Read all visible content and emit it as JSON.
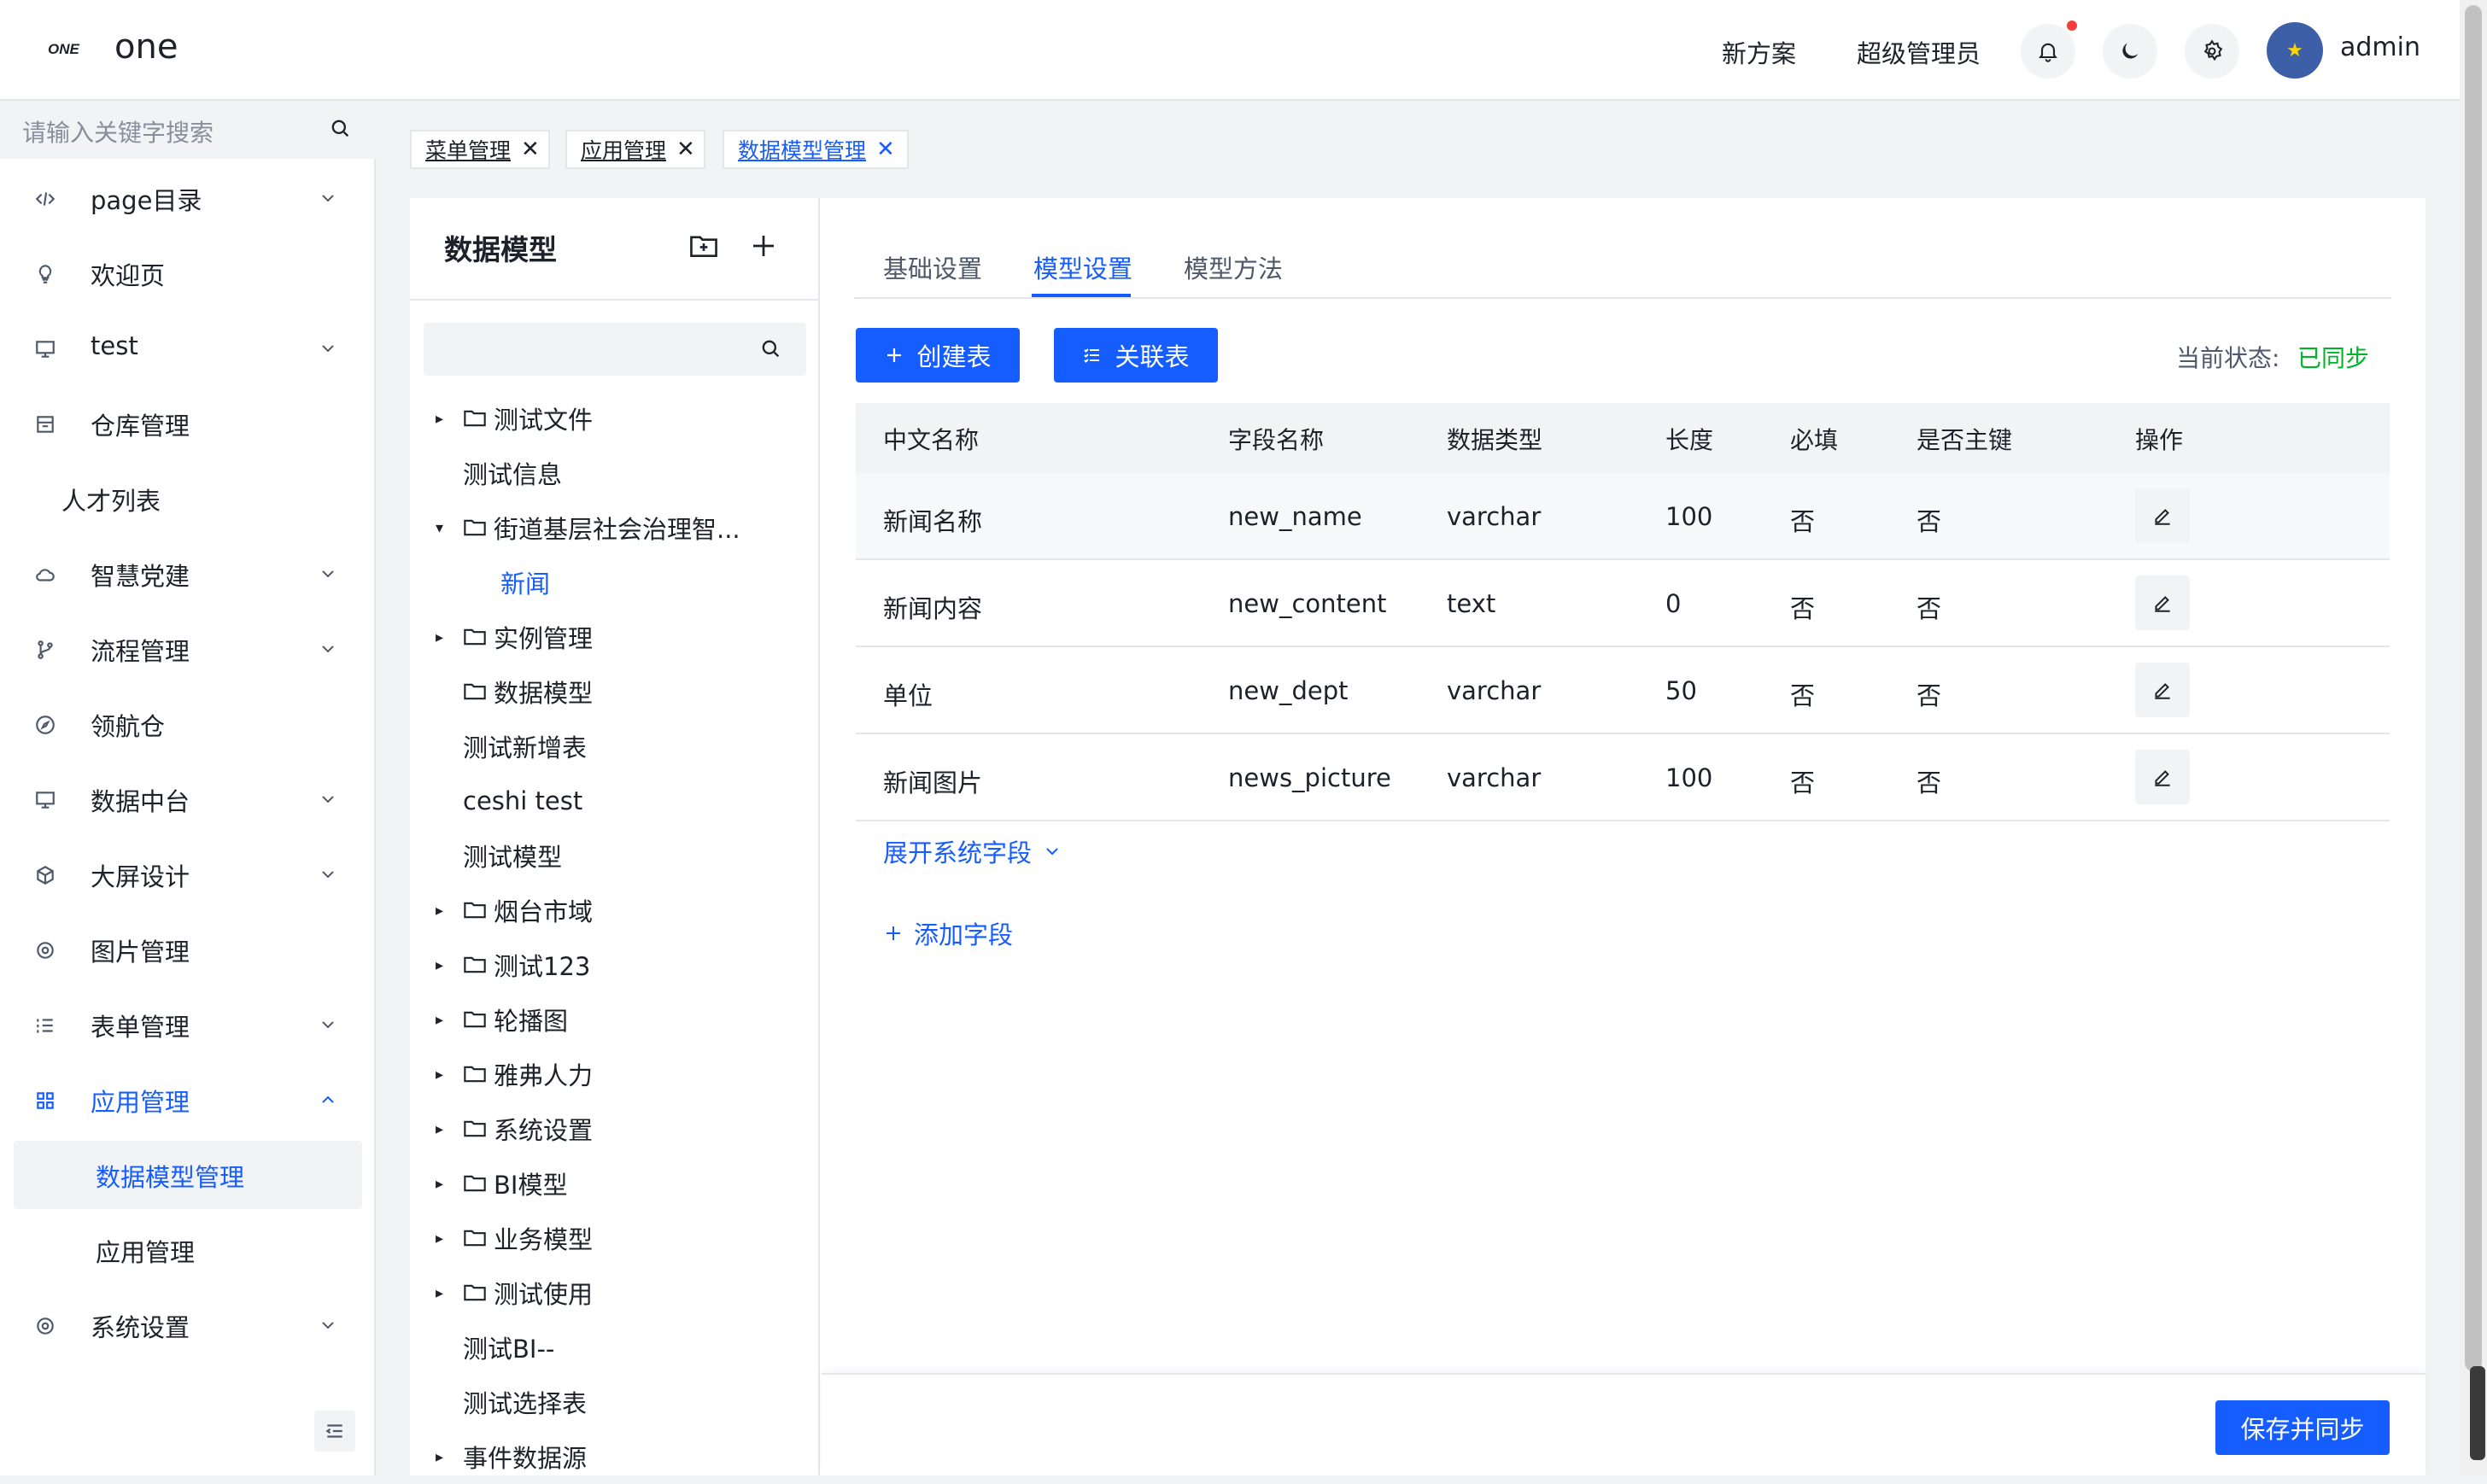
{
  "header": {
    "app_title": "one",
    "logo_text": "ONE",
    "links": [
      "新方案",
      "超级管理员"
    ],
    "user": "admin"
  },
  "sidebar": {
    "search_placeholder": "请输入关键字搜索",
    "items": [
      {
        "label": "page目录",
        "icon": "code-icon",
        "has_arrow": true
      },
      {
        "label": "欢迎页",
        "icon": "bulb-icon",
        "has_arrow": false
      },
      {
        "label": "test",
        "icon": "desktop-icon",
        "has_arrow": true
      },
      {
        "label": "仓库管理",
        "icon": "storage-icon",
        "has_arrow": false
      },
      {
        "label": "人才列表",
        "icon": "",
        "has_arrow": false
      },
      {
        "label": "智慧党建",
        "icon": "cloud-icon",
        "has_arrow": true
      },
      {
        "label": "流程管理",
        "icon": "branch-icon",
        "has_arrow": true
      },
      {
        "label": "领航仓",
        "icon": "compass-icon",
        "has_arrow": false
      },
      {
        "label": "数据中台",
        "icon": "desktop-icon",
        "has_arrow": true
      },
      {
        "label": "大屏设计",
        "icon": "cube-icon",
        "has_arrow": true
      },
      {
        "label": "图片管理",
        "icon": "gear-icon",
        "has_arrow": false
      },
      {
        "label": "表单管理",
        "icon": "ordered-list-icon",
        "has_arrow": true
      },
      {
        "label": "应用管理",
        "icon": "apps-icon",
        "has_arrow": true
      },
      {
        "label": "数据模型管理",
        "icon": "",
        "has_arrow": false
      },
      {
        "label": "应用管理",
        "icon": "",
        "has_arrow": false
      },
      {
        "label": "系统设置",
        "icon": "gear-icon",
        "has_arrow": true
      }
    ]
  },
  "tabs": [
    "菜单管理",
    "应用管理",
    "数据模型管理"
  ],
  "tree": {
    "title": "数据模型",
    "nodes": [
      {
        "label": "测试文件",
        "caret": "▸",
        "folder": true
      },
      {
        "label": "测试信息",
        "caret": "",
        "folder": false
      },
      {
        "label": "街道基层社会治理智...",
        "caret": "▾",
        "folder": true
      },
      {
        "label": "新闻",
        "caret": "",
        "folder": false
      },
      {
        "label": "实例管理",
        "caret": "▸",
        "folder": true
      },
      {
        "label": "数据模型",
        "caret": "",
        "folder": true
      },
      {
        "label": "测试新增表",
        "caret": "",
        "folder": false
      },
      {
        "label": "ceshi test",
        "caret": "",
        "folder": false
      },
      {
        "label": "测试模型",
        "caret": "",
        "folder": false
      },
      {
        "label": "烟台市域",
        "caret": "▸",
        "folder": true
      },
      {
        "label": "测试123",
        "caret": "▸",
        "folder": true
      },
      {
        "label": "轮播图",
        "caret": "▸",
        "folder": true
      },
      {
        "label": "雅弗人力",
        "caret": "▸",
        "folder": true
      },
      {
        "label": "系统设置",
        "caret": "▸",
        "folder": true
      },
      {
        "label": "BI模型",
        "caret": "▸",
        "folder": true
      },
      {
        "label": "业务模型",
        "caret": "▸",
        "folder": true
      },
      {
        "label": "测试使用",
        "caret": "▸",
        "folder": true
      },
      {
        "label": "测试BI--",
        "caret": "",
        "folder": false
      },
      {
        "label": "测试选择表",
        "caret": "",
        "folder": false
      },
      {
        "label": "事件数据源",
        "caret": "▸",
        "folder": false
      }
    ]
  },
  "main": {
    "tabs": [
      "基础设置",
      "模型设置",
      "模型方法"
    ],
    "create_btn": "创建表",
    "link_btn": "关联表",
    "status_label": "当前状态:",
    "status_value": "已同步",
    "columns": [
      "中文名称",
      "字段名称",
      "数据类型",
      "长度",
      "必填",
      "是否主键",
      "操作"
    ],
    "rows": [
      [
        "新闻名称",
        "new_name",
        "varchar",
        "100",
        "否",
        "否"
      ],
      [
        "新闻内容",
        "new_content",
        "text",
        "0",
        "否",
        "否"
      ],
      [
        "单位",
        "new_dept",
        "varchar",
        "50",
        "否",
        "否"
      ],
      [
        "新闻图片",
        "news_picture",
        "varchar",
        "100",
        "否",
        "否"
      ]
    ],
    "expand_label": "展开系统字段",
    "add_field_label": "添加字段",
    "save_btn": "保存并同步"
  },
  "colors": {
    "primary": "#165dff",
    "success": "#00b42a",
    "notify_dot": "#f53f3f"
  }
}
